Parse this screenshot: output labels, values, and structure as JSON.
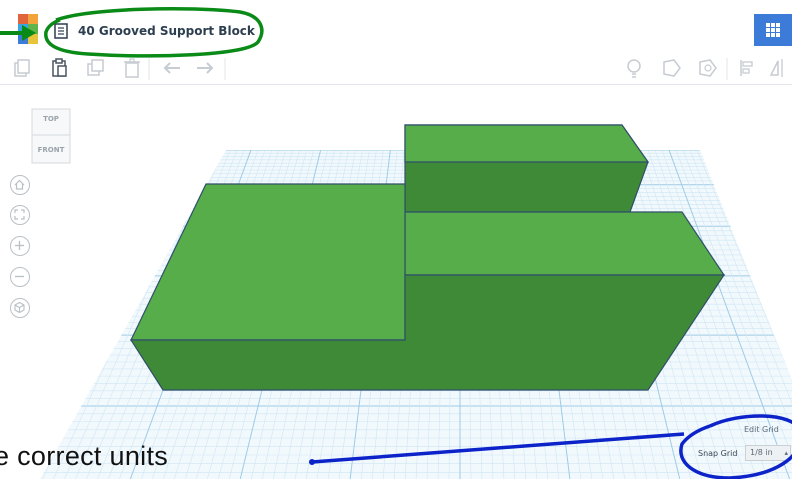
{
  "document": {
    "title": "40 Grooved Support Block"
  },
  "logo": {
    "letters": [
      "T",
      "I",
      "N",
      "K",
      "E",
      "R",
      "C",
      "A",
      "D"
    ]
  },
  "viewcube": {
    "top_label": "TOP",
    "front_label": "FRONT"
  },
  "grid": {
    "edit_label": "Edit Grid",
    "snap_label": "Snap Grid",
    "snap_value": "1/8 in"
  },
  "annotation": {
    "text": "e correct units"
  },
  "colors": {
    "shape_top": "#56ad49",
    "shape_side": "#3f8a37",
    "grid_line": "#cfe6f4",
    "grid_major": "#9fcbe6",
    "accent_blue": "#3c7bd8",
    "annotation_green": "#0a8a17",
    "annotation_blue": "#0b23c9"
  },
  "toolbar_icons": [
    "copy-icon",
    "paste-icon",
    "duplicate-icon",
    "delete-icon",
    "undo-icon",
    "redo-icon",
    "light-bulb-icon",
    "shape-icon",
    "shape-hole-icon",
    "align-icon",
    "mirror-icon"
  ],
  "nav_icons": [
    "home-icon",
    "fit-view-icon",
    "zoom-in-icon",
    "zoom-out-icon",
    "perspective-icon"
  ]
}
